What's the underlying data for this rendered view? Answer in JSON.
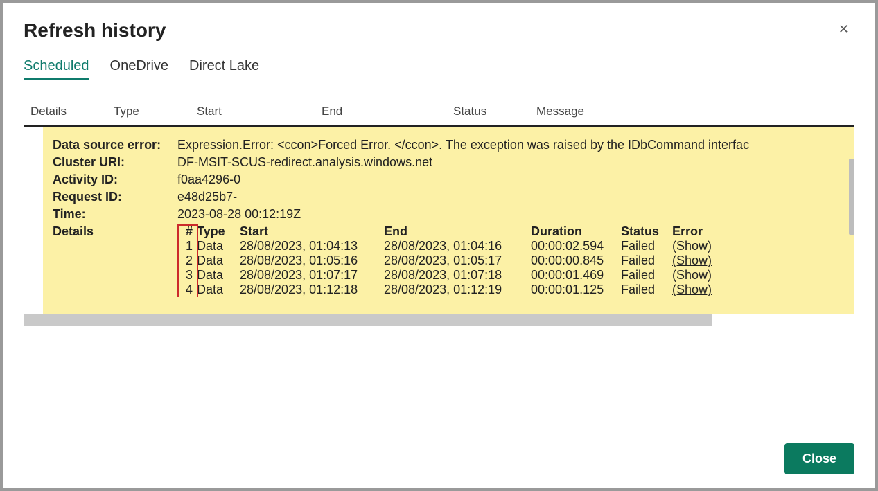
{
  "dialog": {
    "title": "Refresh history",
    "close_x": "✕",
    "close_button": "Close"
  },
  "tabs": [
    "Scheduled",
    "OneDrive",
    "Direct Lake"
  ],
  "active_tab": 0,
  "table_columns": {
    "details": "Details",
    "type": "Type",
    "start": "Start",
    "end": "End",
    "status": "Status",
    "message": "Message"
  },
  "error_panel": {
    "fields": {
      "data_source_error": {
        "label": "Data source error:",
        "value": "Expression.Error: <ccon>Forced Error. </ccon>. The exception was raised by the IDbCommand interfac"
      },
      "cluster_uri": {
        "label": "Cluster URI:",
        "value": "DF-MSIT-SCUS-redirect.analysis.windows.net"
      },
      "activity_id": {
        "label": "Activity ID:",
        "value": "f0aa4296-0"
      },
      "request_id": {
        "label": "Request ID:",
        "value": "e48d25b7-"
      },
      "time": {
        "label": "Time:",
        "value": "2023-08-28 00:12:19Z"
      },
      "details": {
        "label": "Details"
      }
    },
    "detail_headers": {
      "num": "#",
      "type": "Type",
      "start": "Start",
      "end": "End",
      "duration": "Duration",
      "status": "Status",
      "error": "Error"
    },
    "detail_rows": [
      {
        "num": "1",
        "type": "Data",
        "start": "28/08/2023, 01:04:13",
        "end": "28/08/2023, 01:04:16",
        "duration": "00:00:02.594",
        "status": "Failed",
        "error": "(Show)"
      },
      {
        "num": "2",
        "type": "Data",
        "start": "28/08/2023, 01:05:16",
        "end": "28/08/2023, 01:05:17",
        "duration": "00:00:00.845",
        "status": "Failed",
        "error": "(Show)"
      },
      {
        "num": "3",
        "type": "Data",
        "start": "28/08/2023, 01:07:17",
        "end": "28/08/2023, 01:07:18",
        "duration": "00:00:01.469",
        "status": "Failed",
        "error": "(Show)"
      },
      {
        "num": "4",
        "type": "Data",
        "start": "28/08/2023, 01:12:18",
        "end": "28/08/2023, 01:12:19",
        "duration": "00:00:01.125",
        "status": "Failed",
        "error": "(Show)"
      }
    ]
  }
}
